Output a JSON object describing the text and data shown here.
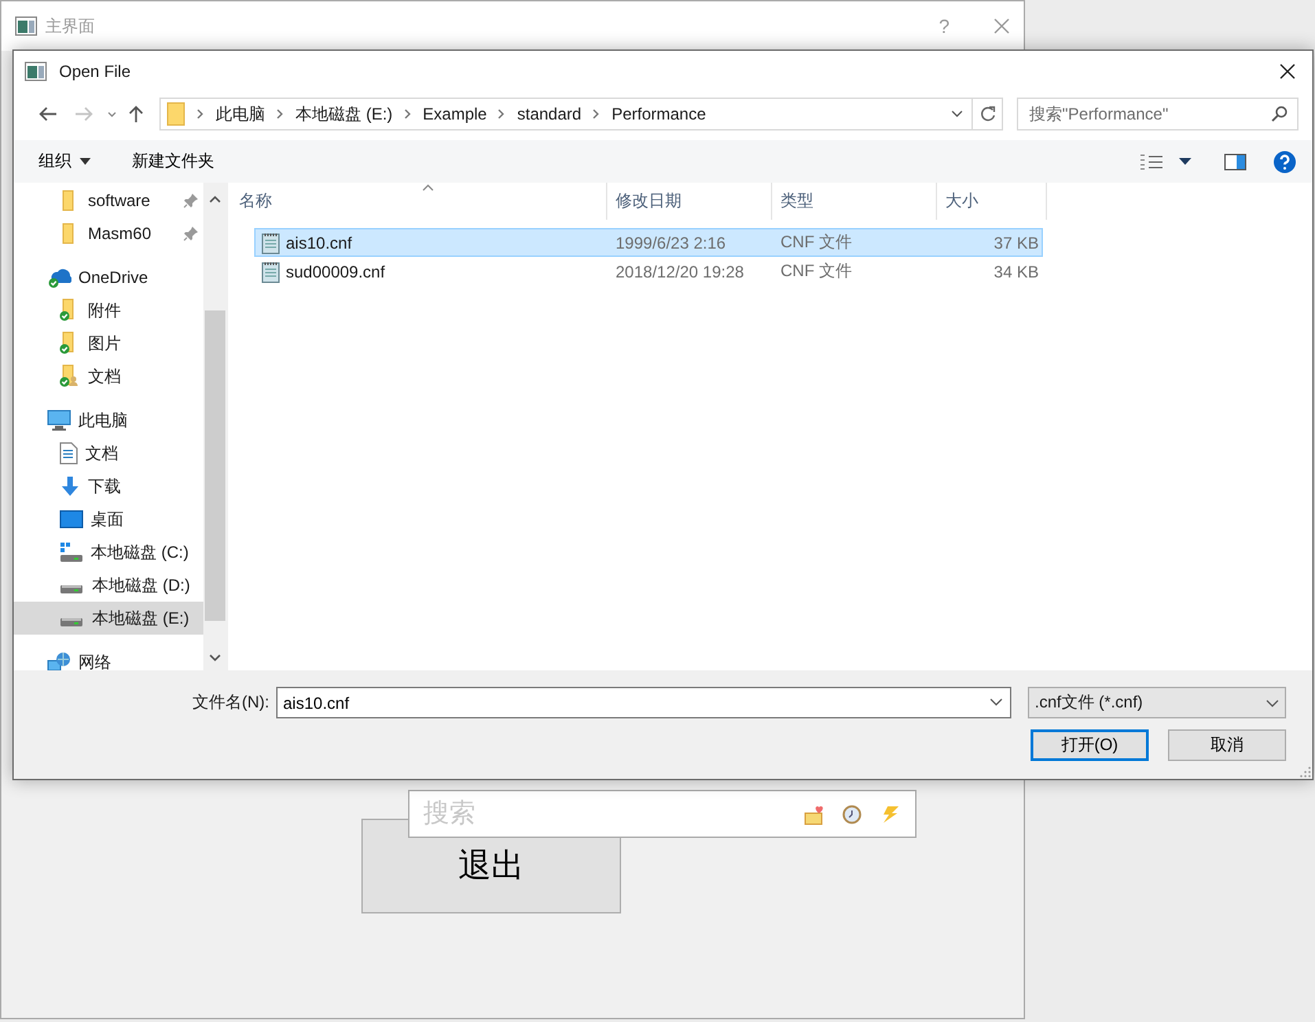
{
  "main_window": {
    "title": "主界面",
    "help_label": "?",
    "search": {
      "placeholder": "搜索"
    },
    "exit_button": "退出"
  },
  "dialog": {
    "title": "Open File",
    "breadcrumb": [
      "此电脑",
      "本地磁盘 (E:)",
      "Example",
      "standard",
      "Performance"
    ],
    "search": {
      "placeholder": "搜索\"Performance\""
    },
    "toolbar": {
      "organize": "组织",
      "new_folder": "新建文件夹"
    },
    "quick_access": [
      {
        "kind": "folder",
        "label": "software",
        "pinned": true,
        "selected": false
      },
      {
        "kind": "folder",
        "label": "Masm60",
        "pinned": true,
        "selected": false
      }
    ],
    "nav": [
      {
        "kind": "cloud",
        "label": "OneDrive",
        "selected": false,
        "children": [
          {
            "kind": "synced-folder",
            "label": "附件",
            "selected": false
          },
          {
            "kind": "synced-folder",
            "label": "图片",
            "selected": false
          },
          {
            "kind": "shared-folder",
            "label": "文档",
            "selected": false
          }
        ]
      },
      {
        "kind": "pc",
        "label": "此电脑",
        "selected": false,
        "children": [
          {
            "kind": "document",
            "label": "文档",
            "selected": false
          },
          {
            "kind": "download",
            "label": "下载",
            "selected": false
          },
          {
            "kind": "desktop",
            "label": "桌面",
            "selected": false
          },
          {
            "kind": "system-drive",
            "label": "本地磁盘 (C:)",
            "selected": false
          },
          {
            "kind": "drive",
            "label": "本地磁盘 (D:)",
            "selected": false
          },
          {
            "kind": "drive",
            "label": "本地磁盘 (E:)",
            "selected": true
          }
        ]
      },
      {
        "kind": "network",
        "label": "网络",
        "selected": false
      }
    ],
    "columns": [
      "名称",
      "修改日期",
      "类型",
      "大小"
    ],
    "files": [
      {
        "name": "ais10.cnf",
        "date": "1999/6/23 2:16",
        "type": "CNF 文件",
        "size": "37 KB",
        "selected": true
      },
      {
        "name": "sud00009.cnf",
        "date": "2018/12/20 19:28",
        "type": "CNF 文件",
        "size": "34 KB",
        "selected": false
      }
    ],
    "filename": {
      "label": "文件名(N):",
      "value": "ais10.cnf"
    },
    "filter": ".cnf文件 (*.cnf)",
    "open_button": "打开(O)",
    "cancel_button": "取消"
  }
}
